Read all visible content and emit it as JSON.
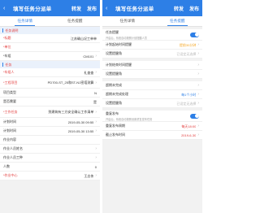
{
  "app": {
    "back": "‹",
    "title": "填写任务分派单",
    "action1": "转发",
    "action2": "发布"
  },
  "tabs": [
    "任务详情",
    "任务提醒"
  ],
  "left": {
    "section1": "任务说明",
    "rows1": [
      {
        "label": "*标题",
        "value": "江苏确山况工单单",
        "req": true
      },
      {
        "label": "*单位",
        "value": "",
        "req": true
      },
      {
        "label": "*车组",
        "value": "CM101",
        "req": false
      }
    ],
    "section2": "任务",
    "rows2": [
      {
        "label": "*车组人",
        "value": "礼查查",
        "req": true
      },
      {
        "label": "*工程项目",
        "value": "PD700-ST_25和ST-N1密塔测算",
        "req": true
      },
      {
        "label": "项目类型",
        "value": "N",
        "req": false
      },
      {
        "label": "是否需要",
        "value": "是",
        "req": false
      },
      {
        "label": "*工作任务",
        "value": "到建筑有三方安全确认工作清单",
        "req": true
      },
      {
        "label": "计划时间",
        "value": "2019-05-30 09:55",
        "req": false
      },
      {
        "label": "计划时间",
        "value": "2019-05-30 13:55",
        "req": false
      },
      {
        "label": "作业内容",
        "value": "",
        "req": false
      },
      {
        "label": "作业人员姓名",
        "value": "",
        "req": false
      },
      {
        "label": "作业人员工种",
        "value": "",
        "req": false
      },
      {
        "label": "人数",
        "value": "0",
        "req": false
      },
      {
        "label": "*作业中心",
        "value": "王志伟",
        "req": true
      }
    ]
  },
  "right": {
    "task_reminder": {
      "title": "任务提醒",
      "sub": "开启后，系统自动按照计划提醒人员"
    },
    "rows_a": [
      {
        "label": "计划起始时间提醒",
        "value": "提前30分钟",
        "tone": "orange"
      },
      {
        "label": "设置提醒角",
        "value": "已设定无选择",
        "tone": "muted"
      }
    ],
    "rows_b": [
      {
        "label": "计划结束时间提醒",
        "value": "",
        "tone": "muted"
      },
      {
        "label": "设置提醒角",
        "value": "",
        "tone": "muted"
      }
    ],
    "rows_c": [
      {
        "label": "超期未完成",
        "value": "",
        "tone": "muted"
      },
      {
        "label": "超期未完成处理",
        "value": "每1个小时",
        "tone": "blue"
      },
      {
        "label": "设置提醒角",
        "value": "已设定无选择",
        "tone": "muted"
      }
    ],
    "publish_reminder": {
      "title": "重复发布",
      "sub": "开启后，系统自动按照设置重复发布任务"
    },
    "rows_d": [
      {
        "label": "重复发布周期",
        "value": "每天18:00",
        "tone": "red"
      },
      {
        "label": "截止发布时间",
        "value": "2019-6-30",
        "tone": "red"
      }
    ]
  }
}
